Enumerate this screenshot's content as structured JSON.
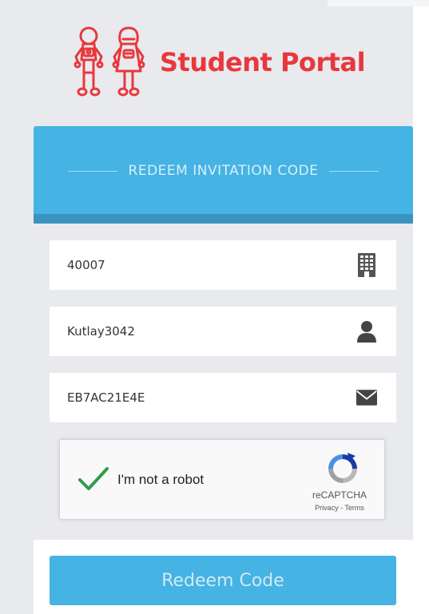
{
  "brand": {
    "title": "Student Portal",
    "color": "#e8383d",
    "icon": "kids-logo-icon"
  },
  "form": {
    "header": "REDEEM INVITATION CODE",
    "header_color": "#45b3e3",
    "fields": [
      {
        "value": "40007",
        "icon": "building-icon"
      },
      {
        "value": "Kutlay3042",
        "icon": "user-icon"
      },
      {
        "value": "EB7AC21E4E",
        "icon": "envelope-icon"
      }
    ],
    "recaptcha": {
      "label": "I'm not a robot",
      "checked": true,
      "brand": "reCAPTCHA",
      "privacy": "Privacy",
      "separator": " - ",
      "terms": "Terms"
    },
    "submit_label": "Redeem Code"
  }
}
